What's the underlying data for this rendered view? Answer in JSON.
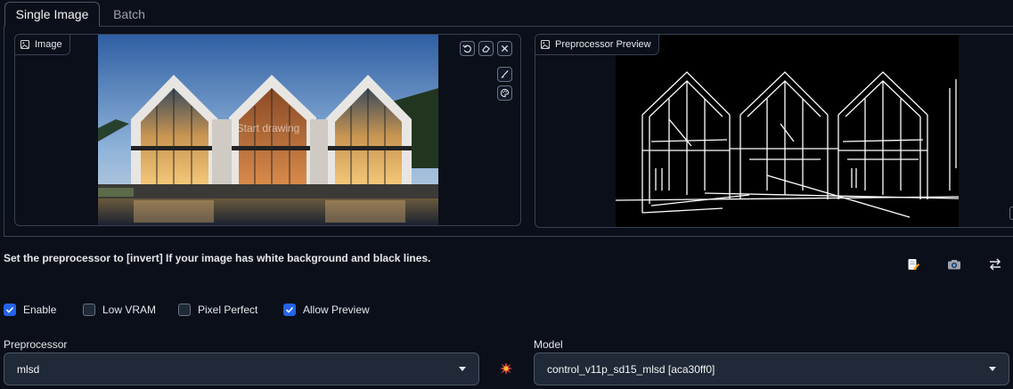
{
  "tabs": [
    {
      "label": "Single Image",
      "active": true
    },
    {
      "label": "Batch",
      "active": false
    }
  ],
  "image_panel": {
    "label": "Image",
    "overlay_text": "Start drawing",
    "tools": [
      "undo-icon",
      "eraser-icon",
      "close-icon",
      "brush-icon",
      "palette-icon"
    ]
  },
  "preview_panel": {
    "label": "Preprocessor Preview"
  },
  "hint": "Set the preprocessor to [invert] If your image has white background and black lines.",
  "utility_icons": [
    "edit-icon",
    "camera-icon",
    "swap-icon"
  ],
  "options": [
    {
      "label": "Enable",
      "checked": true
    },
    {
      "label": "Low VRAM",
      "checked": false
    },
    {
      "label": "Pixel Perfect",
      "checked": false
    },
    {
      "label": "Allow Preview",
      "checked": true
    }
  ],
  "preprocessor": {
    "label": "Preprocessor",
    "value": "mlsd"
  },
  "model": {
    "label": "Model",
    "value": "control_v11p_sd15_mlsd [aca30ff0]"
  },
  "run_icon": "explosion-icon",
  "colors": {
    "background": "#0b0f19",
    "border": "#374151",
    "accent": "#2563eb",
    "input_bg": "#1f2937"
  }
}
